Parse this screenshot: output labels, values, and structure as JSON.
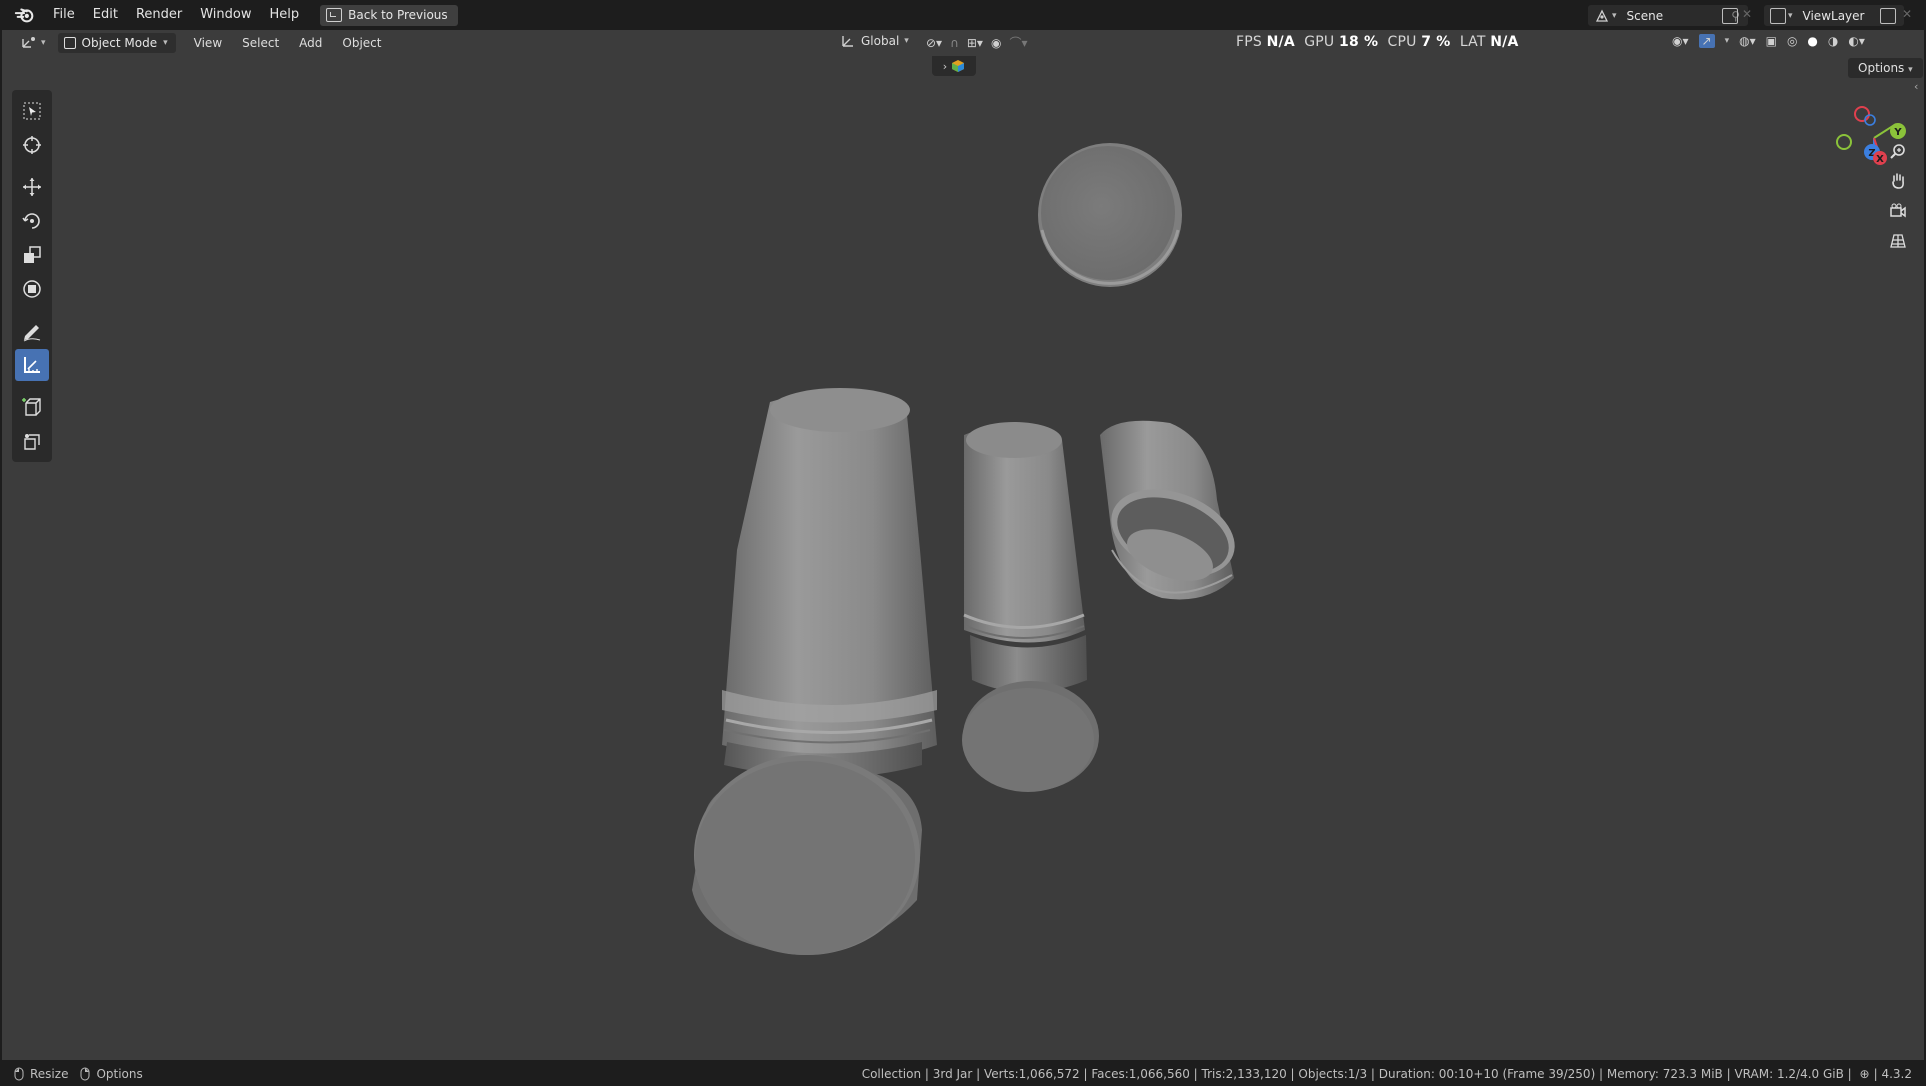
{
  "menubar": {
    "items": [
      "File",
      "Edit",
      "Render",
      "Window",
      "Help"
    ],
    "back_button": "Back to Previous",
    "scene_label": "Scene",
    "viewlayer_label": "ViewLayer"
  },
  "viewport_header": {
    "mode": "Object Mode",
    "menus": [
      "View",
      "Select",
      "Add",
      "Object"
    ],
    "orientation": "Global",
    "options_label": "Options"
  },
  "stats": {
    "fps_label": "FPS",
    "fps_value": "N/A",
    "gpu_label": "GPU",
    "gpu_value": "18 %",
    "cpu_label": "CPU",
    "cpu_value": "7 %",
    "lat_label": "LAT",
    "lat_value": "N/A"
  },
  "toolbar": {
    "tools": [
      "select-box",
      "cursor",
      "move",
      "rotate",
      "scale",
      "transform",
      "annotate",
      "measure",
      "add-cube",
      "extrude"
    ],
    "active_tool": "measure"
  },
  "navigation_gizmo": {
    "axes": [
      "Y",
      "Z",
      "X"
    ]
  },
  "statusbar": {
    "left_resize": "Resize",
    "left_options": "Options",
    "right_text": "Collection | 3rd Jar | Verts:1,066,572 | Faces:1,066,560 | Tris:2,133,120 | Objects:1/3 | Duration: 00:10+10 (Frame 39/250) | Memory: 723.3 MiB | VRAM: 1.2/4.0 GiB |",
    "version": "4.3.2"
  },
  "colors": {
    "accent": "#4772b3",
    "viewport_bg": "#3c3c3c",
    "axis_x": "#e0404e",
    "axis_y": "#8bc33a",
    "axis_z": "#3b7fe0"
  }
}
